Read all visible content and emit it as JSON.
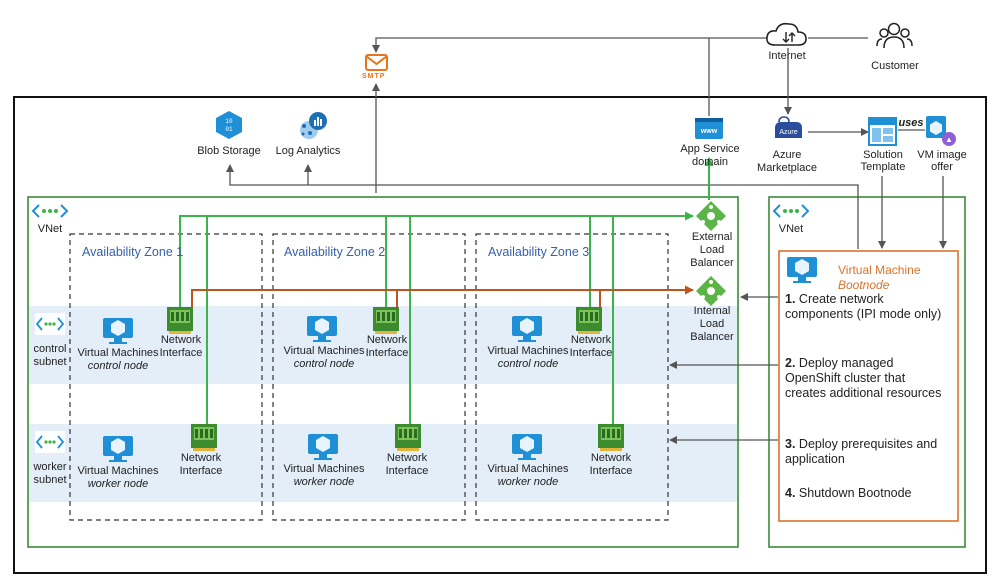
{
  "top": {
    "smtp": "SMTP",
    "internet": "Internet",
    "customer": "Customer",
    "blob_storage": "Blob Storage",
    "log_analytics": "Log Analytics",
    "app_service": "App Service",
    "app_service_2": "domain",
    "azure_badge": "Azure",
    "azure_marketplace": "Azure",
    "azure_marketplace_2": "Marketplace",
    "solution_template": "Solution",
    "solution_template_2": "Template",
    "uses": "uses",
    "vm_image": "VM image",
    "vm_image_2": "offer",
    "www": "www"
  },
  "vnet_left": "VNet",
  "vnet_right": "VNet",
  "zones": [
    "Availability Zone 1",
    "Availability Zone 2",
    "Availability Zone 3"
  ],
  "subnets": {
    "control": [
      "control",
      "subnet"
    ],
    "worker": [
      "worker",
      "subnet"
    ]
  },
  "nodes": {
    "vm_label": "Virtual Machines",
    "control_node": "control node",
    "worker_node": "worker node",
    "nic_label_1": "Network",
    "nic_label_2": "Interface"
  },
  "load_balancers": {
    "external": [
      "External",
      "Load",
      "Balancer"
    ],
    "internal": [
      "Internal",
      "Load",
      "Balancer"
    ]
  },
  "bootnode": {
    "title": "Virtual Machine",
    "subtitle": "Bootnode",
    "step1_num": "1.",
    "step1_a": "Create network",
    "step1_b": "components (IPI mode only)",
    "step2_num": "2.",
    "step2_a": "Deploy managed",
    "step2_b": "OpenShift cluster that",
    "step2_c": "creates additional resources",
    "step3_num": "3.",
    "step3_a": "Deploy prerequisites and",
    "step3_b": "application",
    "step4_num": "4.",
    "step4_a": "Shutdown Bootnode"
  },
  "colors": {
    "green_border": "#3b8a3b",
    "green_line": "#3cb44b",
    "orange_line": "#c0541f",
    "subnet_band": "#e3eef9",
    "azure_blue": "#1f8fd6",
    "bootnode_orange": "#d8732b"
  }
}
